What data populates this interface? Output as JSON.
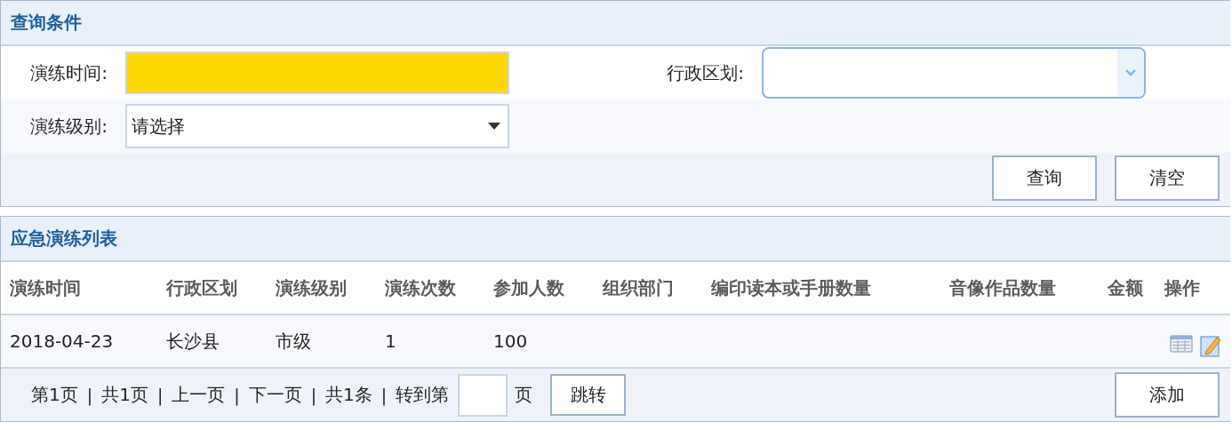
{
  "query_panel": {
    "title": "查询条件",
    "fields": [
      {
        "kind": "text",
        "label": "演练时间:",
        "highlighted": true
      },
      {
        "kind": "combo",
        "label": "行政区划:"
      },
      {
        "kind": "select",
        "label": "演练级别:",
        "value": "请选择"
      }
    ],
    "buttons": [
      "查询",
      "清空"
    ]
  },
  "list_panel": {
    "title": "应急演练列表",
    "table": {
      "columns": [
        "演练时间",
        "行政区划",
        "演练级别",
        "演练次数",
        "参加人数",
        "组织部门",
        "编印读本或手册数量",
        "音像作品数量",
        "金额",
        "操作"
      ],
      "rows": [
        {
          "cells": [
            "2018-04-23",
            "长沙县",
            "市级",
            "1",
            "100"
          ],
          "actions": [
            {
              "kind": "view"
            },
            {
              "kind": "edit"
            }
          ]
        }
      ]
    },
    "pager": {
      "segments": [
        {
          "kind": "text",
          "text": "第1页"
        },
        {
          "kind": "separator",
          "text": "|"
        },
        {
          "kind": "text",
          "text": "共1页"
        },
        {
          "kind": "separator",
          "text": "|"
        },
        {
          "kind": "text",
          "text": "上一页"
        },
        {
          "kind": "separator",
          "text": "|"
        },
        {
          "kind": "text",
          "text": "下一页"
        },
        {
          "kind": "separator",
          "text": "|"
        },
        {
          "kind": "text",
          "text": "共1条"
        },
        {
          "kind": "separator",
          "text": "|"
        },
        {
          "kind": "text",
          "text": "转到第"
        }
      ],
      "page_suffix": "页",
      "goto_button": "跳转"
    },
    "add_button": "添加"
  }
}
